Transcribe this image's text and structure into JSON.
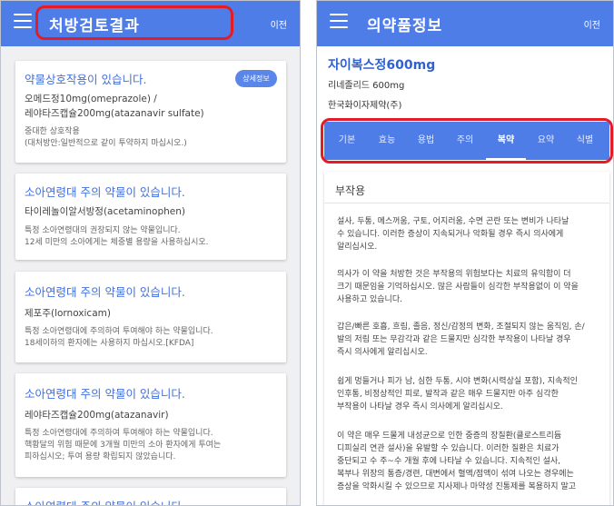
{
  "left": {
    "title": "처방검토결과",
    "prev_label": "이전",
    "detail_label": "상세정보",
    "cards": [
      {
        "title": "약물상호작용이 있습니다.",
        "drug_line1": "오메드정10mg(omeprazole) /",
        "drug_line2": "레야타즈캡슐200mg(atazanavir sulfate)",
        "note_line1": "중대한 상호작용",
        "note_line2": "(대처방안:일반적으로 같이 투약하지 마십시오.)"
      },
      {
        "title": "소아연령대 주의 약물이 있습니다.",
        "drug_line1": "타이레놀이알서방정(acetaminophen)",
        "note_line1": "특정 소아연령대의 권장되지 않는 약물입니다.",
        "note_line2": "12세 미만의 소아에게는 체중별 용량을 사용하십시오."
      },
      {
        "title": "소아연령대 주의 약물이 있습니다.",
        "drug_line1": "제포주(lornoxicam)",
        "note_line1": "특정 소아연령대에 주의하여 투여해야 하는 약물입니다.",
        "note_line2": "18세이하의 환자에는 사용하지 마십시오.[KFDA]"
      },
      {
        "title": "소아연령대 주의 약물이 있습니다.",
        "drug_line1": "레야타즈캡슐200mg(atazanavir)",
        "note_line1": "특정 소아연령대에 주의하여 투여해야 하는 약물입니다.",
        "note_line2": "핵황달의 위험 때문에 3개월 미만의 소아 환자에게 투여는",
        "note_line3": "피하십시오; 투여 용량 확립되지 않았습니다."
      },
      {
        "title": "소아연령대 주의 약물이 있습니다."
      }
    ]
  },
  "right": {
    "title": "의약품정보",
    "prev_label": "이전",
    "drug_name": "자이복스정600mg",
    "ingredient": "리네졸리드 600mg",
    "company": "한국화이자제약(주)",
    "tabs": [
      "기본",
      "효능",
      "용법",
      "주의",
      "복약",
      "요약",
      "식별"
    ],
    "active_tab": "복약",
    "section_title": "부작용",
    "paragraphs": [
      [
        "설사, 두통, 메스꺼움, 구토, 어지러움, 수면 곤란 또는 변비가 나타날",
        "수 있습니다. 이러한 증상이 지속되거나 악화될 경우 즉시 의사에게",
        "알리십시오."
      ],
      [
        "의사가 이 약을 처방한 것은 부작용의 위험보다는 치료의 유익함이 더",
        "크기 때문임을 기억하십시오. 많은 사람들이 심각한 부작용없이 이 약을",
        "사용하고 있습니다."
      ],
      [
        "갑은/빠른 호흡, 흐림, 졸음, 정신/감정의 변화, 조절되지 않는 움직임, 손/",
        "발의 저림 또는 무감각과 같은 드물지만 심각한 부작용이 나타날 경우",
        "즉시 의사에게 알리십시오."
      ],
      [
        "쉽게 멍들거나 피가 남, 심한 두통, 시야 변화(시력상실 포함), 지속적인",
        "인후통, 비정상적인 피로, 발작과 같은 매우 드물지만 아주 심각한",
        "부작용이 나타날 경우 즉시 의사에게 알리십시오."
      ],
      [
        "이 약은 매우 드물게 내성균으로 인한 중증의 장질환(클로스트리듐",
        "디피실리 연관 설사)을 유발할 수 있습니다. 이러한 질환은 치료가",
        "중단되고 수 주~수 개월 후에 나타날 수 있습니다. 지속적인 설사,",
        "복부나 위장의 통증/경련, 대변에서 혈액/점액이 섞여 나오는 경우에는",
        "증상을 악화시킬 수 있으므로 지사제나 마약성 진통제를 복용하지 말고"
      ]
    ]
  }
}
